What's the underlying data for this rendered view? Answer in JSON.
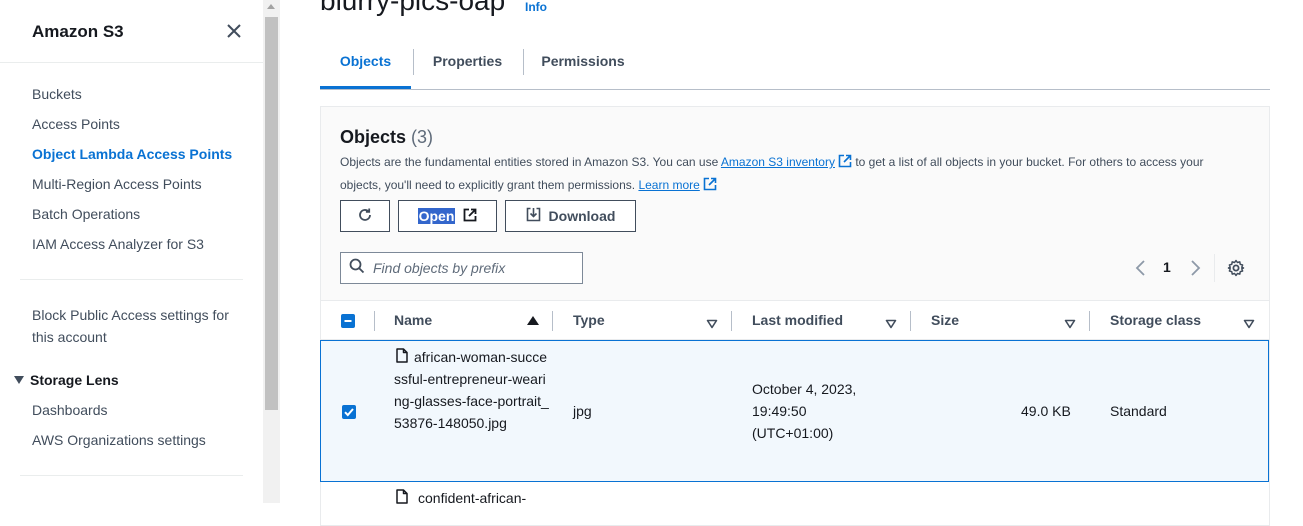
{
  "sidebar": {
    "title": "Amazon S3",
    "items": [
      {
        "label": "Buckets"
      },
      {
        "label": "Access Points"
      },
      {
        "label": "Object Lambda Access Points"
      },
      {
        "label": "Multi-Region Access Points"
      },
      {
        "label": "Batch Operations"
      },
      {
        "label": "IAM Access Analyzer for S3"
      }
    ],
    "block_public": "Block Public Access settings for this account",
    "storage_lens": {
      "label": "Storage Lens",
      "items": [
        {
          "label": "Dashboards"
        },
        {
          "label": "AWS Organizations settings"
        }
      ]
    }
  },
  "header": {
    "bucket_name": "blurry-pics-oap",
    "info": "Info"
  },
  "tabs": [
    {
      "label": "Objects",
      "active": true
    },
    {
      "label": "Properties"
    },
    {
      "label": "Permissions"
    }
  ],
  "objects_panel": {
    "title": "Objects",
    "count": "(3)",
    "desc_1": "Objects are the fundamental entities stored in Amazon S3. You can use ",
    "desc_link_1": "Amazon S3 inventory",
    "desc_2": " to get a list of all objects in your bucket. For others to access your objects, you'll need to explicitly grant them permissions. ",
    "desc_link_2": "Learn more",
    "buttons": {
      "open": "Open",
      "download": "Download"
    },
    "search_placeholder": "Find objects by prefix",
    "page": "1"
  },
  "table": {
    "columns": [
      "Name",
      "Type",
      "Last modified",
      "Size",
      "Storage class"
    ],
    "rows": [
      {
        "name": "african-woman-successful-entrepreneur-wearing-glasses-face-portrait_53876-148050.jpg",
        "type": "jpg",
        "last_modified": "October 4, 2023, 19:49:50 (UTC+01:00)",
        "size": "49.0 KB",
        "storage_class": "Standard"
      },
      {
        "name": "confident-african-"
      }
    ]
  },
  "colors": {
    "accent": "#0972d3",
    "text": "#16191f",
    "muted": "#414d5c"
  }
}
